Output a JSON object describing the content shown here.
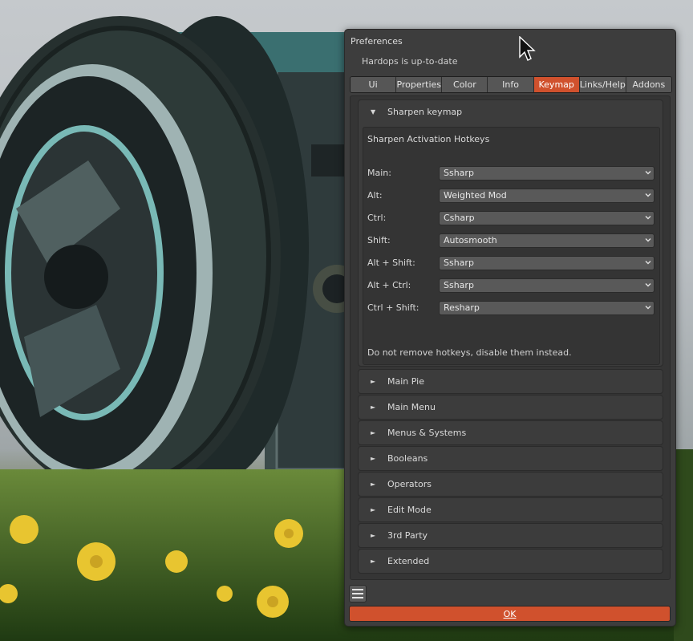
{
  "window": {
    "title": "Preferences",
    "status": "Hardops is up-to-date"
  },
  "tabs": [
    {
      "label": "Ui",
      "active": false
    },
    {
      "label": "Properties",
      "active": false
    },
    {
      "label": "Color",
      "active": false
    },
    {
      "label": "Info",
      "active": false
    },
    {
      "label": "Keymap",
      "active": true
    },
    {
      "label": "Links/Help",
      "active": false
    },
    {
      "label": "Addons",
      "active": false
    }
  ],
  "sharpen": {
    "header": "Sharpen keymap",
    "expanded": true,
    "subtitle": "Sharpen Activation Hotkeys",
    "rows": [
      {
        "label": "Main:",
        "value": "Ssharp"
      },
      {
        "label": "Alt:",
        "value": "Weighted Mod"
      },
      {
        "label": "Ctrl:",
        "value": "Csharp"
      },
      {
        "label": "Shift:",
        "value": "Autosmooth"
      },
      {
        "label": "Alt + Shift:",
        "value": "Ssharp"
      },
      {
        "label": "Alt + Ctrl:",
        "value": "Ssharp"
      },
      {
        "label": "Ctrl + Shift:",
        "value": "Resharp"
      }
    ],
    "note": "Do not remove hotkeys, disable them instead."
  },
  "collapsed_sections": [
    {
      "label": "Main Pie"
    },
    {
      "label": "Main Menu"
    },
    {
      "label": "Menus & Systems"
    },
    {
      "label": "Booleans"
    },
    {
      "label": "Operators"
    },
    {
      "label": "Edit Mode"
    },
    {
      "label": "3rd Party"
    },
    {
      "label": "Extended"
    }
  ],
  "footer": {
    "ok_label": "OK",
    "menu_icon": "hamburger-menu-icon"
  },
  "icons": {
    "expanded_glyph": "▼",
    "collapsed_glyph": "►"
  },
  "colors": {
    "accent": "#d0512d",
    "panel": "#3d3d3d",
    "field": "#595959"
  }
}
